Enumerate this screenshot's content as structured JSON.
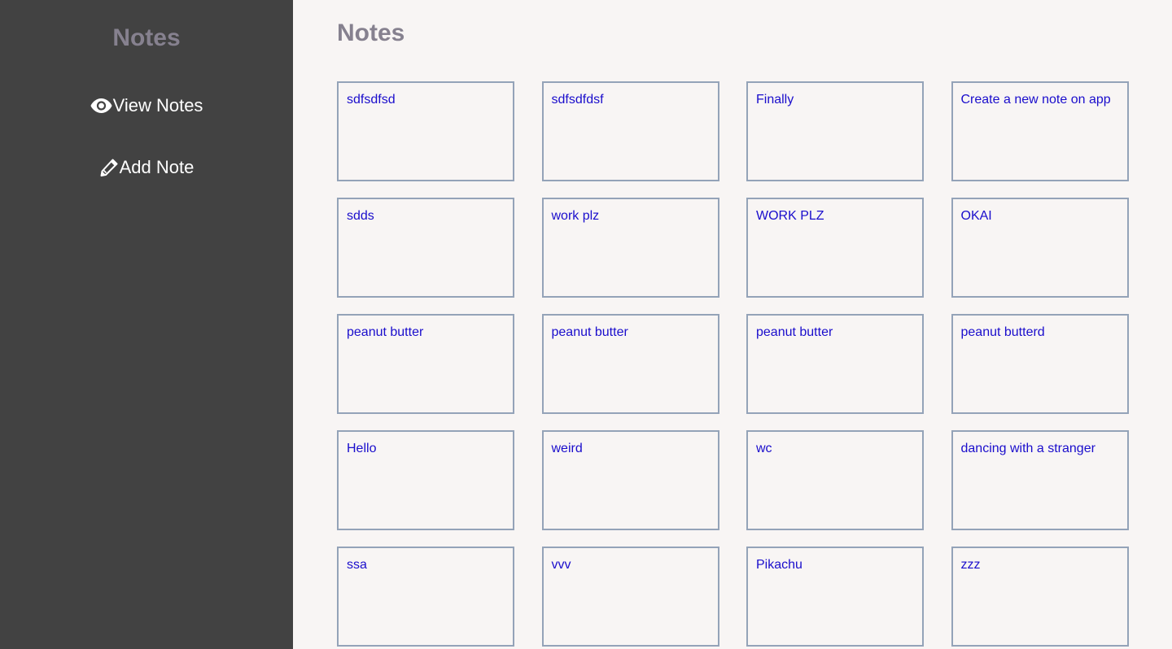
{
  "sidebar": {
    "title": "Notes",
    "nav": [
      {
        "label": "View Notes",
        "icon": "eye-icon"
      },
      {
        "label": "Add Note",
        "icon": "pencil-icon"
      }
    ]
  },
  "main": {
    "title": "Notes",
    "notes": [
      "sdfsdfsd",
      "sdfsdfdsf",
      "Finally",
      "Create a new note on app",
      "sdds",
      "work plz",
      "WORK PLZ",
      "OKAI",
      "peanut butter",
      "peanut butter",
      "peanut butter",
      "peanut butterd",
      "Hello",
      "weird",
      "wc",
      "dancing with a stranger",
      "ssa",
      "vvv",
      "Pikachu",
      "zzz"
    ]
  },
  "colors": {
    "sidebar_bg": "#424242",
    "page_bg": "#f8f5f4",
    "title": "#86818f",
    "note_text": "#1a0dcc",
    "note_border": "#94a3b8"
  }
}
